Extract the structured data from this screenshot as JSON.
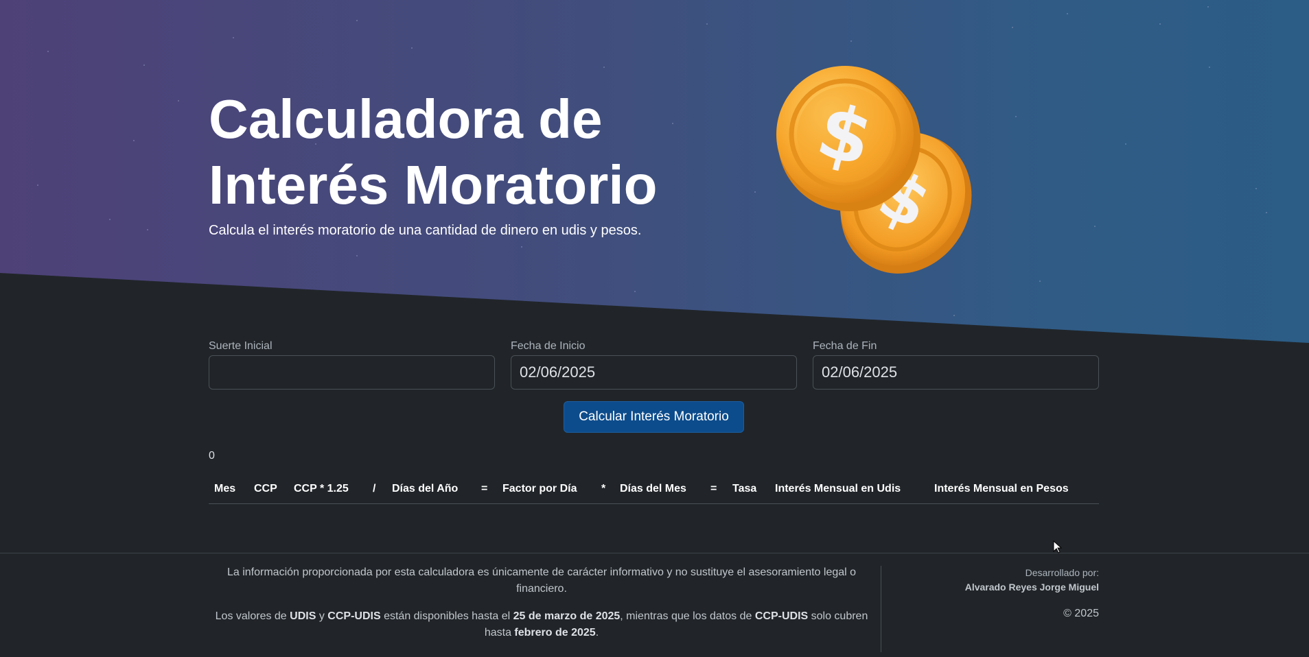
{
  "hero": {
    "title_line1": "Calculadora de",
    "title_line2": "Interés Moratorio",
    "subtitle": "Calcula el interés moratorio de una cantidad de dinero en udis y pesos."
  },
  "form": {
    "principal": {
      "label": "Suerte Inicial",
      "value": ""
    },
    "start_date": {
      "label": "Fecha de Inicio",
      "value": "02/06/2025"
    },
    "end_date": {
      "label": "Fecha de Fin",
      "value": "02/06/2025"
    },
    "submit_label": "Calcular Interés Moratorio"
  },
  "result": {
    "value": "0"
  },
  "table": {
    "headers": [
      "Mes",
      "CCP",
      "CCP * 1.25",
      "/",
      "Días del Año",
      "=",
      "Factor por Día",
      "*",
      "Días del Mes",
      "=",
      "Tasa",
      "Interés Mensual en Udis",
      "Interés Mensual en Pesos"
    ],
    "rows": []
  },
  "footer": {
    "disclaimer": "La información proporcionada por esta calculadora es únicamente de carácter informativo y no sustituye el asesoramiento legal o financiero.",
    "availability": {
      "t1": "Los valores de ",
      "b1": "UDIS",
      "t2": " y ",
      "b2": "CCP-UDIS",
      "t3": " están disponibles hasta el ",
      "b3": "25 de marzo de 2025",
      "t4": ", mientras que los datos de ",
      "b4": "CCP-UDIS",
      "t5": " solo cubren hasta ",
      "b5": "febrero de 2025",
      "t6": "."
    },
    "developed_by_label": "Desarrollado por:",
    "developer_name": "Alvarado Reyes Jorge Miguel",
    "copyright": "© 2025"
  },
  "colors": {
    "hero_gradient_start": "#4e4178",
    "hero_gradient_end": "#2b5d86",
    "background": "#212529",
    "button": "#0d4c8c",
    "coin": "#f5a623"
  },
  "icons": {
    "hero_illustration": "dollar-coins-icon"
  }
}
